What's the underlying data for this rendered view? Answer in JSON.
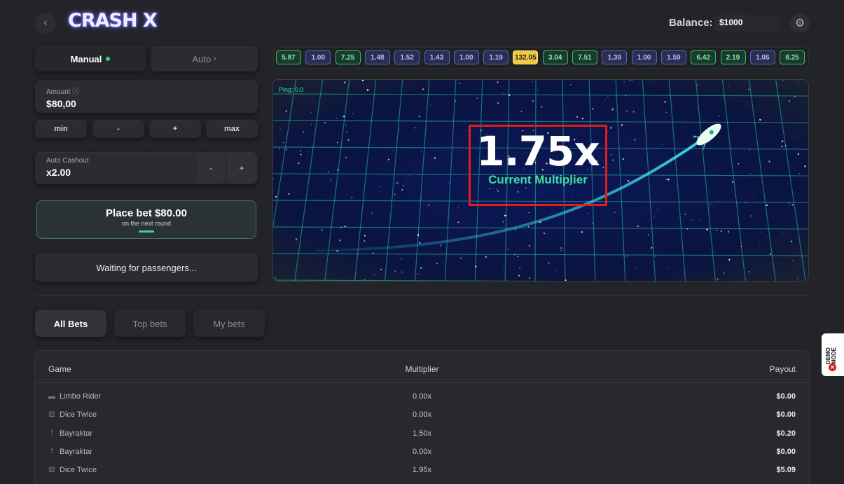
{
  "header": {
    "logo": "CRASH X",
    "balance_label": "Balance:",
    "balance_value": "$1000",
    "back_icon": "chevron-left-icon",
    "settings_icon": "gear-icon"
  },
  "mode_tabs": {
    "manual": "Manual",
    "auto": "Auto"
  },
  "amount": {
    "label": "Amount ⓘ",
    "value": "$80,00"
  },
  "quick_buttons": {
    "min": "min",
    "minus": "-",
    "plus": "+",
    "max": "max"
  },
  "auto_cashout": {
    "label": "Auto Cashout",
    "value": "x2.00",
    "minus": "-",
    "plus": "+"
  },
  "place_bet": {
    "title": "Place bet $80.00",
    "subtitle": "on the next round"
  },
  "waiting_text": "Waiting for passengers...",
  "history": [
    {
      "v": "5.87",
      "c": "green"
    },
    {
      "v": "1.00",
      "c": "blue"
    },
    {
      "v": "7.25",
      "c": "green"
    },
    {
      "v": "1.48",
      "c": "blue"
    },
    {
      "v": "1.52",
      "c": "blue"
    },
    {
      "v": "1.43",
      "c": "blue"
    },
    {
      "v": "1.00",
      "c": "blue"
    },
    {
      "v": "1.19",
      "c": "blue"
    },
    {
      "v": "132.05",
      "c": "gold"
    },
    {
      "v": "3.04",
      "c": "green"
    },
    {
      "v": "7.51",
      "c": "green"
    },
    {
      "v": "1.39",
      "c": "blue"
    },
    {
      "v": "1.00",
      "c": "blue"
    },
    {
      "v": "1.59",
      "c": "blue"
    },
    {
      "v": "6.42",
      "c": "green"
    },
    {
      "v": "2.19",
      "c": "green"
    },
    {
      "v": "1.06",
      "c": "blue"
    },
    {
      "v": "8.25",
      "c": "green"
    }
  ],
  "game": {
    "ping": "Ping: 0.0",
    "multiplier": "1.75x",
    "multiplier_label": "Current Multiplier"
  },
  "bet_tabs": {
    "all": "All Bets",
    "top": "Top bets",
    "mine": "My bets"
  },
  "table": {
    "headers": {
      "game": "Game",
      "multiplier": "Multiplier",
      "payout": "Payout"
    },
    "rows": [
      {
        "game": "Limbo Rider",
        "icon": "car-icon",
        "multiplier": "0.00x",
        "payout": "$0.00"
      },
      {
        "game": "Dice Twice",
        "icon": "dice-icon",
        "multiplier": "0.00x",
        "payout": "$0.00"
      },
      {
        "game": "Bayraktar",
        "icon": "drone-icon",
        "multiplier": "1.50x",
        "payout": "$0.20"
      },
      {
        "game": "Bayraktar",
        "icon": "drone-icon",
        "multiplier": "0.00x",
        "payout": "$0.00"
      },
      {
        "game": "Dice Twice",
        "icon": "dice-icon",
        "multiplier": "1.95x",
        "payout": "$5.09"
      }
    ]
  },
  "demo_badge": "DEMO MODE",
  "colors": {
    "accent_green": "#3ee0a0",
    "highlight_red": "#e21b1b",
    "gold": "#f0c948"
  }
}
